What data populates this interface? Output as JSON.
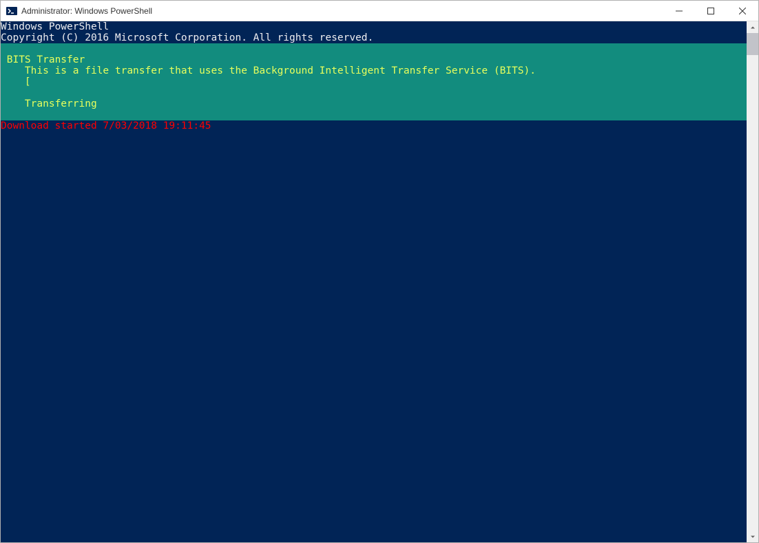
{
  "titlebar": {
    "title": "Administrator: Windows PowerShell"
  },
  "console": {
    "header_line1": "Windows PowerShell",
    "header_line2": "Copyright (C) 2016 Microsoft Corporation. All rights reserved.",
    "progress": {
      "title": "BITS Transfer",
      "description": "    This is a file transfer that uses the Background Intelligent Transfer Service (BITS).",
      "bar_left": "    [",
      "bar_right": "]",
      "bar_fill": "                                                                                                                        ",
      "status": "    Transferring"
    },
    "status_line": "Download started 7/03/2018 19:11:45"
  }
}
